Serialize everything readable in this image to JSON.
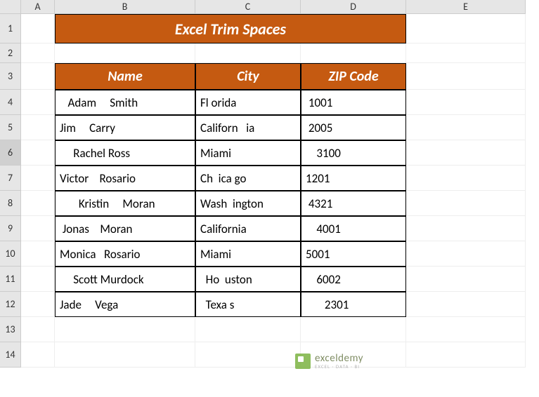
{
  "columns": [
    "A",
    "B",
    "C",
    "D",
    "E"
  ],
  "rows": [
    "1",
    "2",
    "3",
    "4",
    "5",
    "6",
    "7",
    "8",
    "9",
    "10",
    "11",
    "12",
    "13",
    "14"
  ],
  "selectedRow": "6",
  "title": "Excel Trim Spaces",
  "headers": {
    "name": "Name",
    "city": "City",
    "zip": "ZIP Code"
  },
  "data": [
    {
      "name": "   Adam     Smith",
      "city": "Fl orida",
      "zip": " 1001"
    },
    {
      "name": "Jim     Carry",
      "city": "Californ   ia",
      "zip": " 2005"
    },
    {
      "name": "     Rachel Ross",
      "city": "Miami",
      "zip": "    3100"
    },
    {
      "name": "Victor    Rosario",
      "city": "Ch  ica go",
      "zip": "1201"
    },
    {
      "name": "       Kristin     Moran",
      "city": "Wash  ington",
      "zip": " 4321"
    },
    {
      "name": " Jonas    Moran",
      "city": "California",
      "zip": "    4001"
    },
    {
      "name": "Monica   Rosario",
      "city": "Miami",
      "zip": "5001"
    },
    {
      "name": "     Scott Murdock",
      "city": "  Ho  uston",
      "zip": "    6002"
    },
    {
      "name": "Jade     Vega",
      "city": "  Texa s",
      "zip": "       2301"
    }
  ],
  "watermark": {
    "name": "exceldemy",
    "sub": "EXCEL · DATA · BI"
  },
  "chart_data": {
    "type": "table",
    "title": "Excel Trim Spaces",
    "columns": [
      "Name",
      "City",
      "ZIP Code"
    ],
    "rows": [
      [
        "   Adam     Smith",
        "Fl orida",
        " 1001"
      ],
      [
        "Jim     Carry",
        "Californ   ia",
        " 2005"
      ],
      [
        "     Rachel Ross",
        "Miami",
        "    3100"
      ],
      [
        "Victor    Rosario",
        "Ch  ica go",
        "1201"
      ],
      [
        "       Kristin     Moran",
        "Wash  ington",
        " 4321"
      ],
      [
        " Jonas    Moran",
        "California",
        "    4001"
      ],
      [
        "Monica   Rosario",
        "Miami",
        "5001"
      ],
      [
        "     Scott Murdock",
        "  Ho  uston",
        "    6002"
      ],
      [
        "Jade     Vega",
        "  Texa s",
        "       2301"
      ]
    ]
  }
}
